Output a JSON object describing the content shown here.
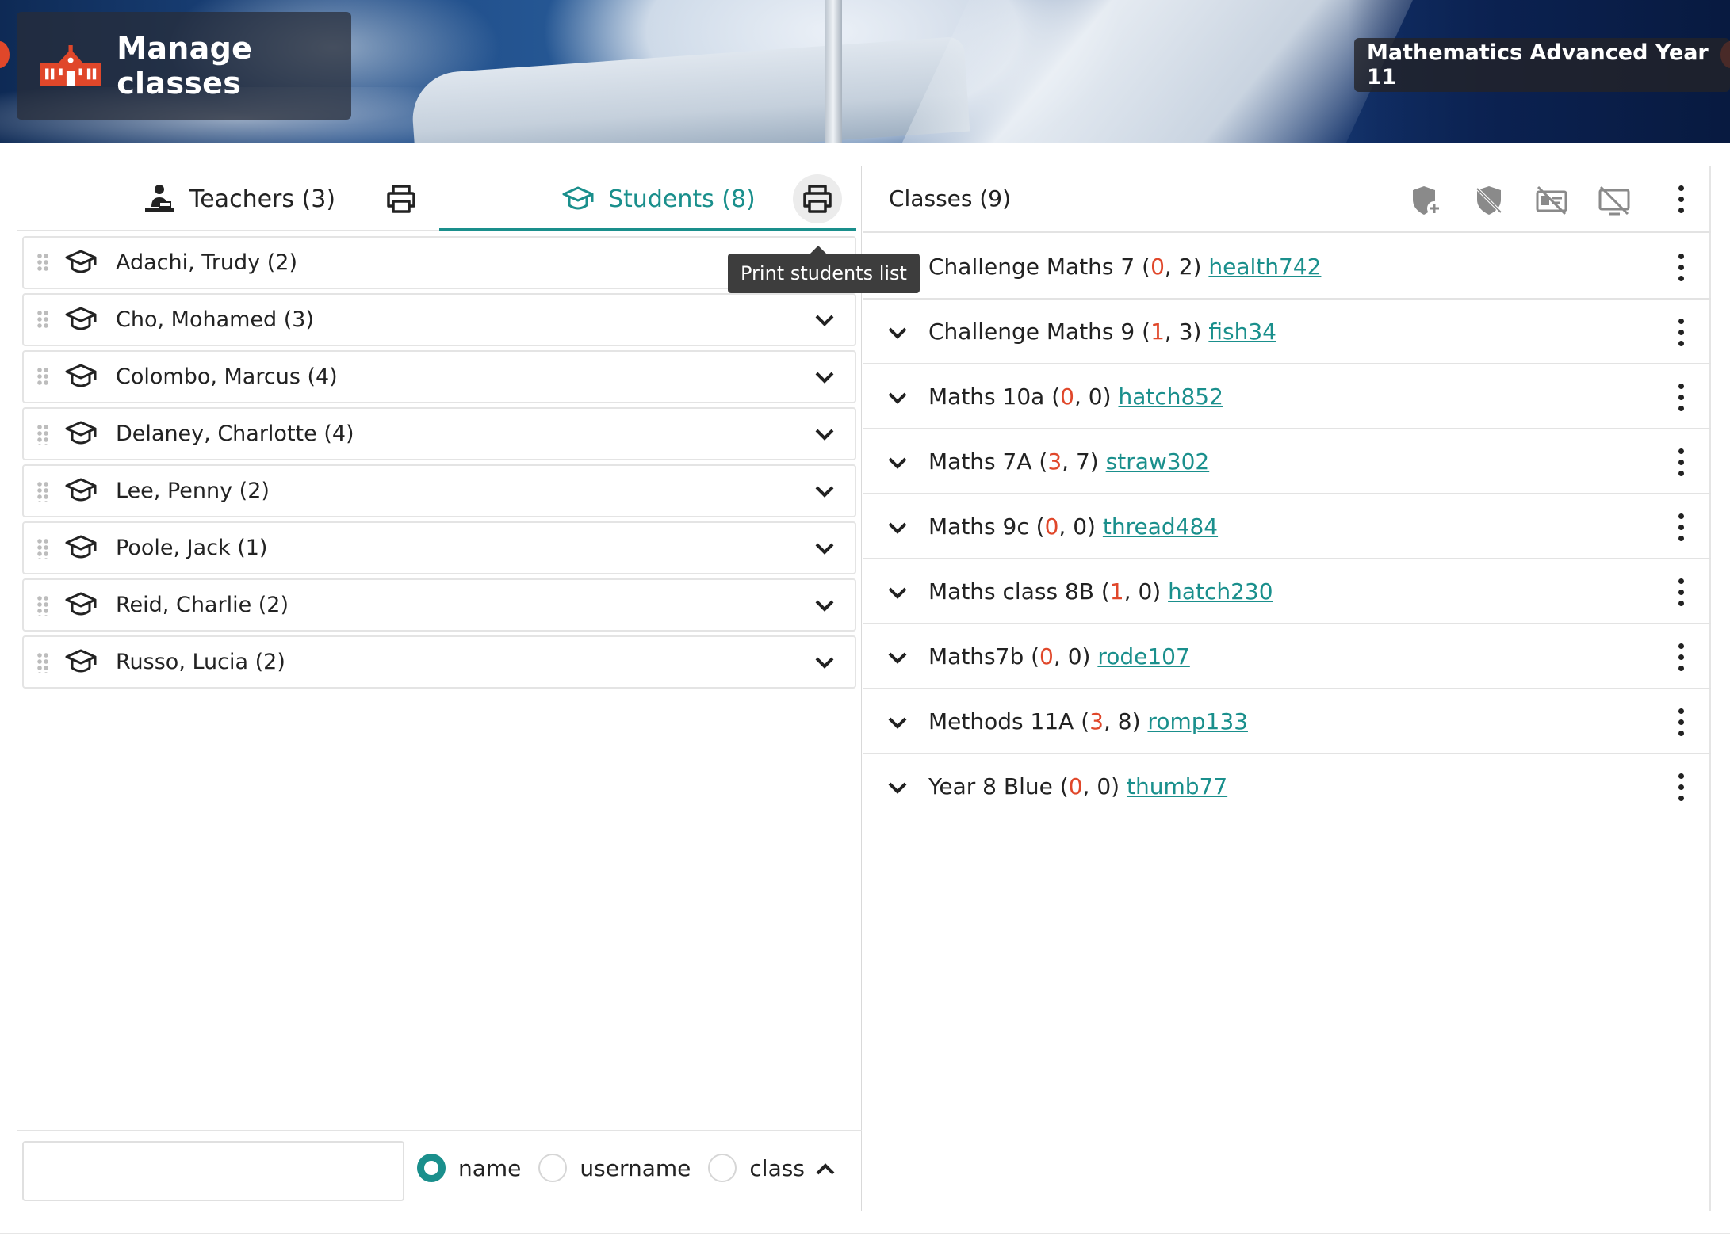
{
  "header": {
    "app_title": "Manage classes",
    "course": "Mathematics Advanced Year 11"
  },
  "tabs": {
    "teachers_label": "Teachers (3)",
    "students_label": "Students (8)"
  },
  "tooltip": "Print students list",
  "students": [
    {
      "name": "Adachi, Trudy (2)"
    },
    {
      "name": "Cho, Mohamed (3)"
    },
    {
      "name": "Colombo, Marcus (4)"
    },
    {
      "name": "Delaney, Charlotte (4)"
    },
    {
      "name": "Lee, Penny (2)"
    },
    {
      "name": "Poole, Jack (1)"
    },
    {
      "name": "Reid, Charlie (2)"
    },
    {
      "name": "Russo, Lucia (2)"
    }
  ],
  "search": {
    "value": "",
    "placeholder": "",
    "options": [
      "name",
      "username",
      "class"
    ],
    "selected": "name"
  },
  "classes": {
    "title": "Classes (9)",
    "items": [
      {
        "name": "Challenge Maths 7",
        "a": "0",
        "b": "2",
        "code": "health742"
      },
      {
        "name": "Challenge Maths 9",
        "a": "1",
        "b": "3",
        "code": "fish34"
      },
      {
        "name": "Maths 10a",
        "a": "0",
        "b": "0",
        "code": "hatch852"
      },
      {
        "name": "Maths 7A",
        "a": "3",
        "b": "7",
        "code": "straw302"
      },
      {
        "name": "Maths 9c",
        "a": "0",
        "b": "0",
        "code": "thread484"
      },
      {
        "name": "Maths class 8B",
        "a": "1",
        "b": "0",
        "code": "hatch230"
      },
      {
        "name": "Maths7b",
        "a": "0",
        "b": "0",
        "code": "rode107"
      },
      {
        "name": "Methods 11A",
        "a": "3",
        "b": "8",
        "code": "romp133"
      },
      {
        "name": "Year 8 Blue",
        "a": "0",
        "b": "0",
        "code": "thumb77"
      }
    ]
  },
  "colors": {
    "accent": "#1a8f8c",
    "highlight": "#e0472a",
    "text": "#222222"
  },
  "icons": {
    "app": "school-building-icon",
    "teachers_tab": "teacher-icon",
    "students_tab": "graduation-cap-icon",
    "print": "printer-icon",
    "header_actions": [
      "add-shield-icon",
      "shield-off-icon",
      "id-card-off-icon",
      "screen-off-icon"
    ]
  }
}
